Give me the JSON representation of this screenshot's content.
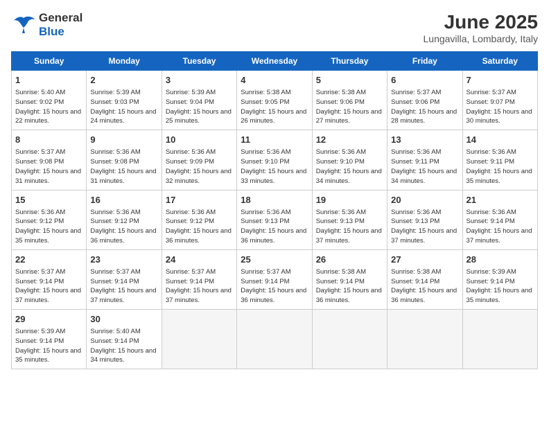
{
  "header": {
    "logo_general": "General",
    "logo_blue": "Blue",
    "month_title": "June 2025",
    "subtitle": "Lungavilla, Lombardy, Italy"
  },
  "weekdays": [
    "Sunday",
    "Monday",
    "Tuesday",
    "Wednesday",
    "Thursday",
    "Friday",
    "Saturday"
  ],
  "weeks": [
    [
      {
        "day": "1",
        "sunrise": "5:40 AM",
        "sunset": "9:02 PM",
        "daylight": "15 hours and 22 minutes."
      },
      {
        "day": "2",
        "sunrise": "5:39 AM",
        "sunset": "9:03 PM",
        "daylight": "15 hours and 24 minutes."
      },
      {
        "day": "3",
        "sunrise": "5:39 AM",
        "sunset": "9:04 PM",
        "daylight": "15 hours and 25 minutes."
      },
      {
        "day": "4",
        "sunrise": "5:38 AM",
        "sunset": "9:05 PM",
        "daylight": "15 hours and 26 minutes."
      },
      {
        "day": "5",
        "sunrise": "5:38 AM",
        "sunset": "9:06 PM",
        "daylight": "15 hours and 27 minutes."
      },
      {
        "day": "6",
        "sunrise": "5:37 AM",
        "sunset": "9:06 PM",
        "daylight": "15 hours and 28 minutes."
      },
      {
        "day": "7",
        "sunrise": "5:37 AM",
        "sunset": "9:07 PM",
        "daylight": "15 hours and 30 minutes."
      }
    ],
    [
      {
        "day": "8",
        "sunrise": "5:37 AM",
        "sunset": "9:08 PM",
        "daylight": "15 hours and 31 minutes."
      },
      {
        "day": "9",
        "sunrise": "5:36 AM",
        "sunset": "9:08 PM",
        "daylight": "15 hours and 31 minutes."
      },
      {
        "day": "10",
        "sunrise": "5:36 AM",
        "sunset": "9:09 PM",
        "daylight": "15 hours and 32 minutes."
      },
      {
        "day": "11",
        "sunrise": "5:36 AM",
        "sunset": "9:10 PM",
        "daylight": "15 hours and 33 minutes."
      },
      {
        "day": "12",
        "sunrise": "5:36 AM",
        "sunset": "9:10 PM",
        "daylight": "15 hours and 34 minutes."
      },
      {
        "day": "13",
        "sunrise": "5:36 AM",
        "sunset": "9:11 PM",
        "daylight": "15 hours and 34 minutes."
      },
      {
        "day": "14",
        "sunrise": "5:36 AM",
        "sunset": "9:11 PM",
        "daylight": "15 hours and 35 minutes."
      }
    ],
    [
      {
        "day": "15",
        "sunrise": "5:36 AM",
        "sunset": "9:12 PM",
        "daylight": "15 hours and 35 minutes."
      },
      {
        "day": "16",
        "sunrise": "5:36 AM",
        "sunset": "9:12 PM",
        "daylight": "15 hours and 36 minutes."
      },
      {
        "day": "17",
        "sunrise": "5:36 AM",
        "sunset": "9:12 PM",
        "daylight": "15 hours and 36 minutes."
      },
      {
        "day": "18",
        "sunrise": "5:36 AM",
        "sunset": "9:13 PM",
        "daylight": "15 hours and 36 minutes."
      },
      {
        "day": "19",
        "sunrise": "5:36 AM",
        "sunset": "9:13 PM",
        "daylight": "15 hours and 37 minutes."
      },
      {
        "day": "20",
        "sunrise": "5:36 AM",
        "sunset": "9:13 PM",
        "daylight": "15 hours and 37 minutes."
      },
      {
        "day": "21",
        "sunrise": "5:36 AM",
        "sunset": "9:14 PM",
        "daylight": "15 hours and 37 minutes."
      }
    ],
    [
      {
        "day": "22",
        "sunrise": "5:37 AM",
        "sunset": "9:14 PM",
        "daylight": "15 hours and 37 minutes."
      },
      {
        "day": "23",
        "sunrise": "5:37 AM",
        "sunset": "9:14 PM",
        "daylight": "15 hours and 37 minutes."
      },
      {
        "day": "24",
        "sunrise": "5:37 AM",
        "sunset": "9:14 PM",
        "daylight": "15 hours and 37 minutes."
      },
      {
        "day": "25",
        "sunrise": "5:37 AM",
        "sunset": "9:14 PM",
        "daylight": "15 hours and 36 minutes."
      },
      {
        "day": "26",
        "sunrise": "5:38 AM",
        "sunset": "9:14 PM",
        "daylight": "15 hours and 36 minutes."
      },
      {
        "day": "27",
        "sunrise": "5:38 AM",
        "sunset": "9:14 PM",
        "daylight": "15 hours and 36 minutes."
      },
      {
        "day": "28",
        "sunrise": "5:39 AM",
        "sunset": "9:14 PM",
        "daylight": "15 hours and 35 minutes."
      }
    ],
    [
      {
        "day": "29",
        "sunrise": "5:39 AM",
        "sunset": "9:14 PM",
        "daylight": "15 hours and 35 minutes."
      },
      {
        "day": "30",
        "sunrise": "5:40 AM",
        "sunset": "9:14 PM",
        "daylight": "15 hours and 34 minutes."
      },
      null,
      null,
      null,
      null,
      null
    ]
  ]
}
